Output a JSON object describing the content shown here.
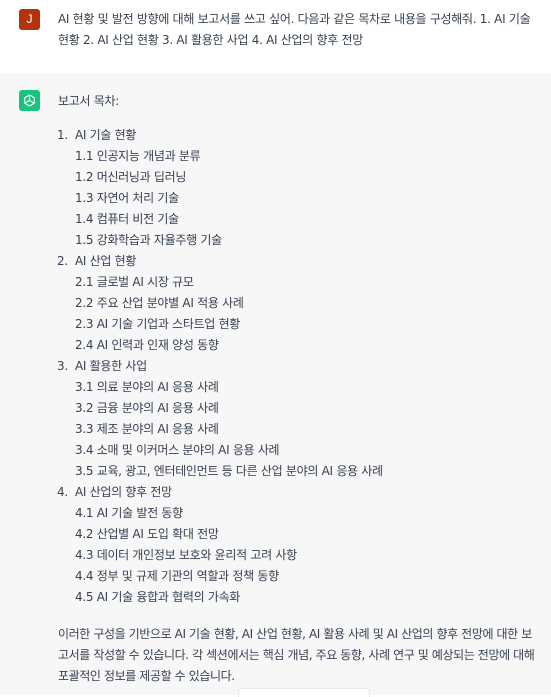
{
  "user_message": {
    "avatar_letter": "J",
    "text": "AI 현황 및 발전 방향에 대해 보고서를 쓰고 싶어. 다음과 같은 목차로 내용을 구성해줘. 1. AI 기술 현황 2. AI 산업 현황 3. AI 활용한 사업 4. AI 산업의 향후 전망"
  },
  "assistant_message": {
    "intro": "보고서 목차:",
    "sections": [
      {
        "number": "1.",
        "title": "AI 기술 현황",
        "items": [
          "1.1 인공지능 개념과 분류",
          "1.2 머신러닝과 딥러닝",
          "1.3 자연어 처리 기술",
          "1.4 컴퓨터 비전 기술",
          "1.5 강화학습과 자율주행 기술"
        ]
      },
      {
        "number": "2.",
        "title": "AI 산업 현황",
        "items": [
          "2.1 글로벌 AI 시장 규모",
          "2.2 주요 산업 분야별 AI 적용 사례",
          "2.3 AI 기술 기업과 스타트업 현황",
          "2.4 AI 인력과 인재 양성 동향"
        ]
      },
      {
        "number": "3.",
        "title": "AI 활용한 사업",
        "items": [
          "3.1 의료 분야의 AI 응용 사례",
          "3.2 금융 분야의 AI 응용 사례",
          "3.3 제조 분야의 AI 응용 사례",
          "3.4 소매 및 이커머스 분야의 AI 응용 사례",
          "3.5 교육, 광고, 엔터테인먼트 등 다른 산업 분야의 AI 응용 사례"
        ]
      },
      {
        "number": "4.",
        "title": "AI 산업의 향후 전망",
        "items": [
          "4.1 AI 기술 발전 동향",
          "4.2 산업별 AI 도입 확대 전망",
          "4.3 데이터 개인정보 보호와 윤리적 고려 사항",
          "4.4 정부 및 규제 기관의 역할과 정책 동향",
          "4.5 AI 기술 융합과 협력의 가속화"
        ]
      }
    ],
    "closing": "이러한 구성을 기반으로 AI 기술 현황, AI 산업 현황, AI 활용 사례 및 AI 산업의 향후 전망에 대한 보고서를 작성할 수 있습니다. 각 섹션에서는 핵심 개념, 주요 동향, 사례 연구 및 예상되는 전망에 대해 포괄적인 정보를 제공할 수 있습니다."
  },
  "colors": {
    "user_avatar": "#b3330c",
    "assistant_avatar": "#19c37d",
    "assistant_bg": "#f7f7f8",
    "text": "#374151"
  },
  "icons": {
    "assistant_avatar": "openai-logo-icon"
  }
}
